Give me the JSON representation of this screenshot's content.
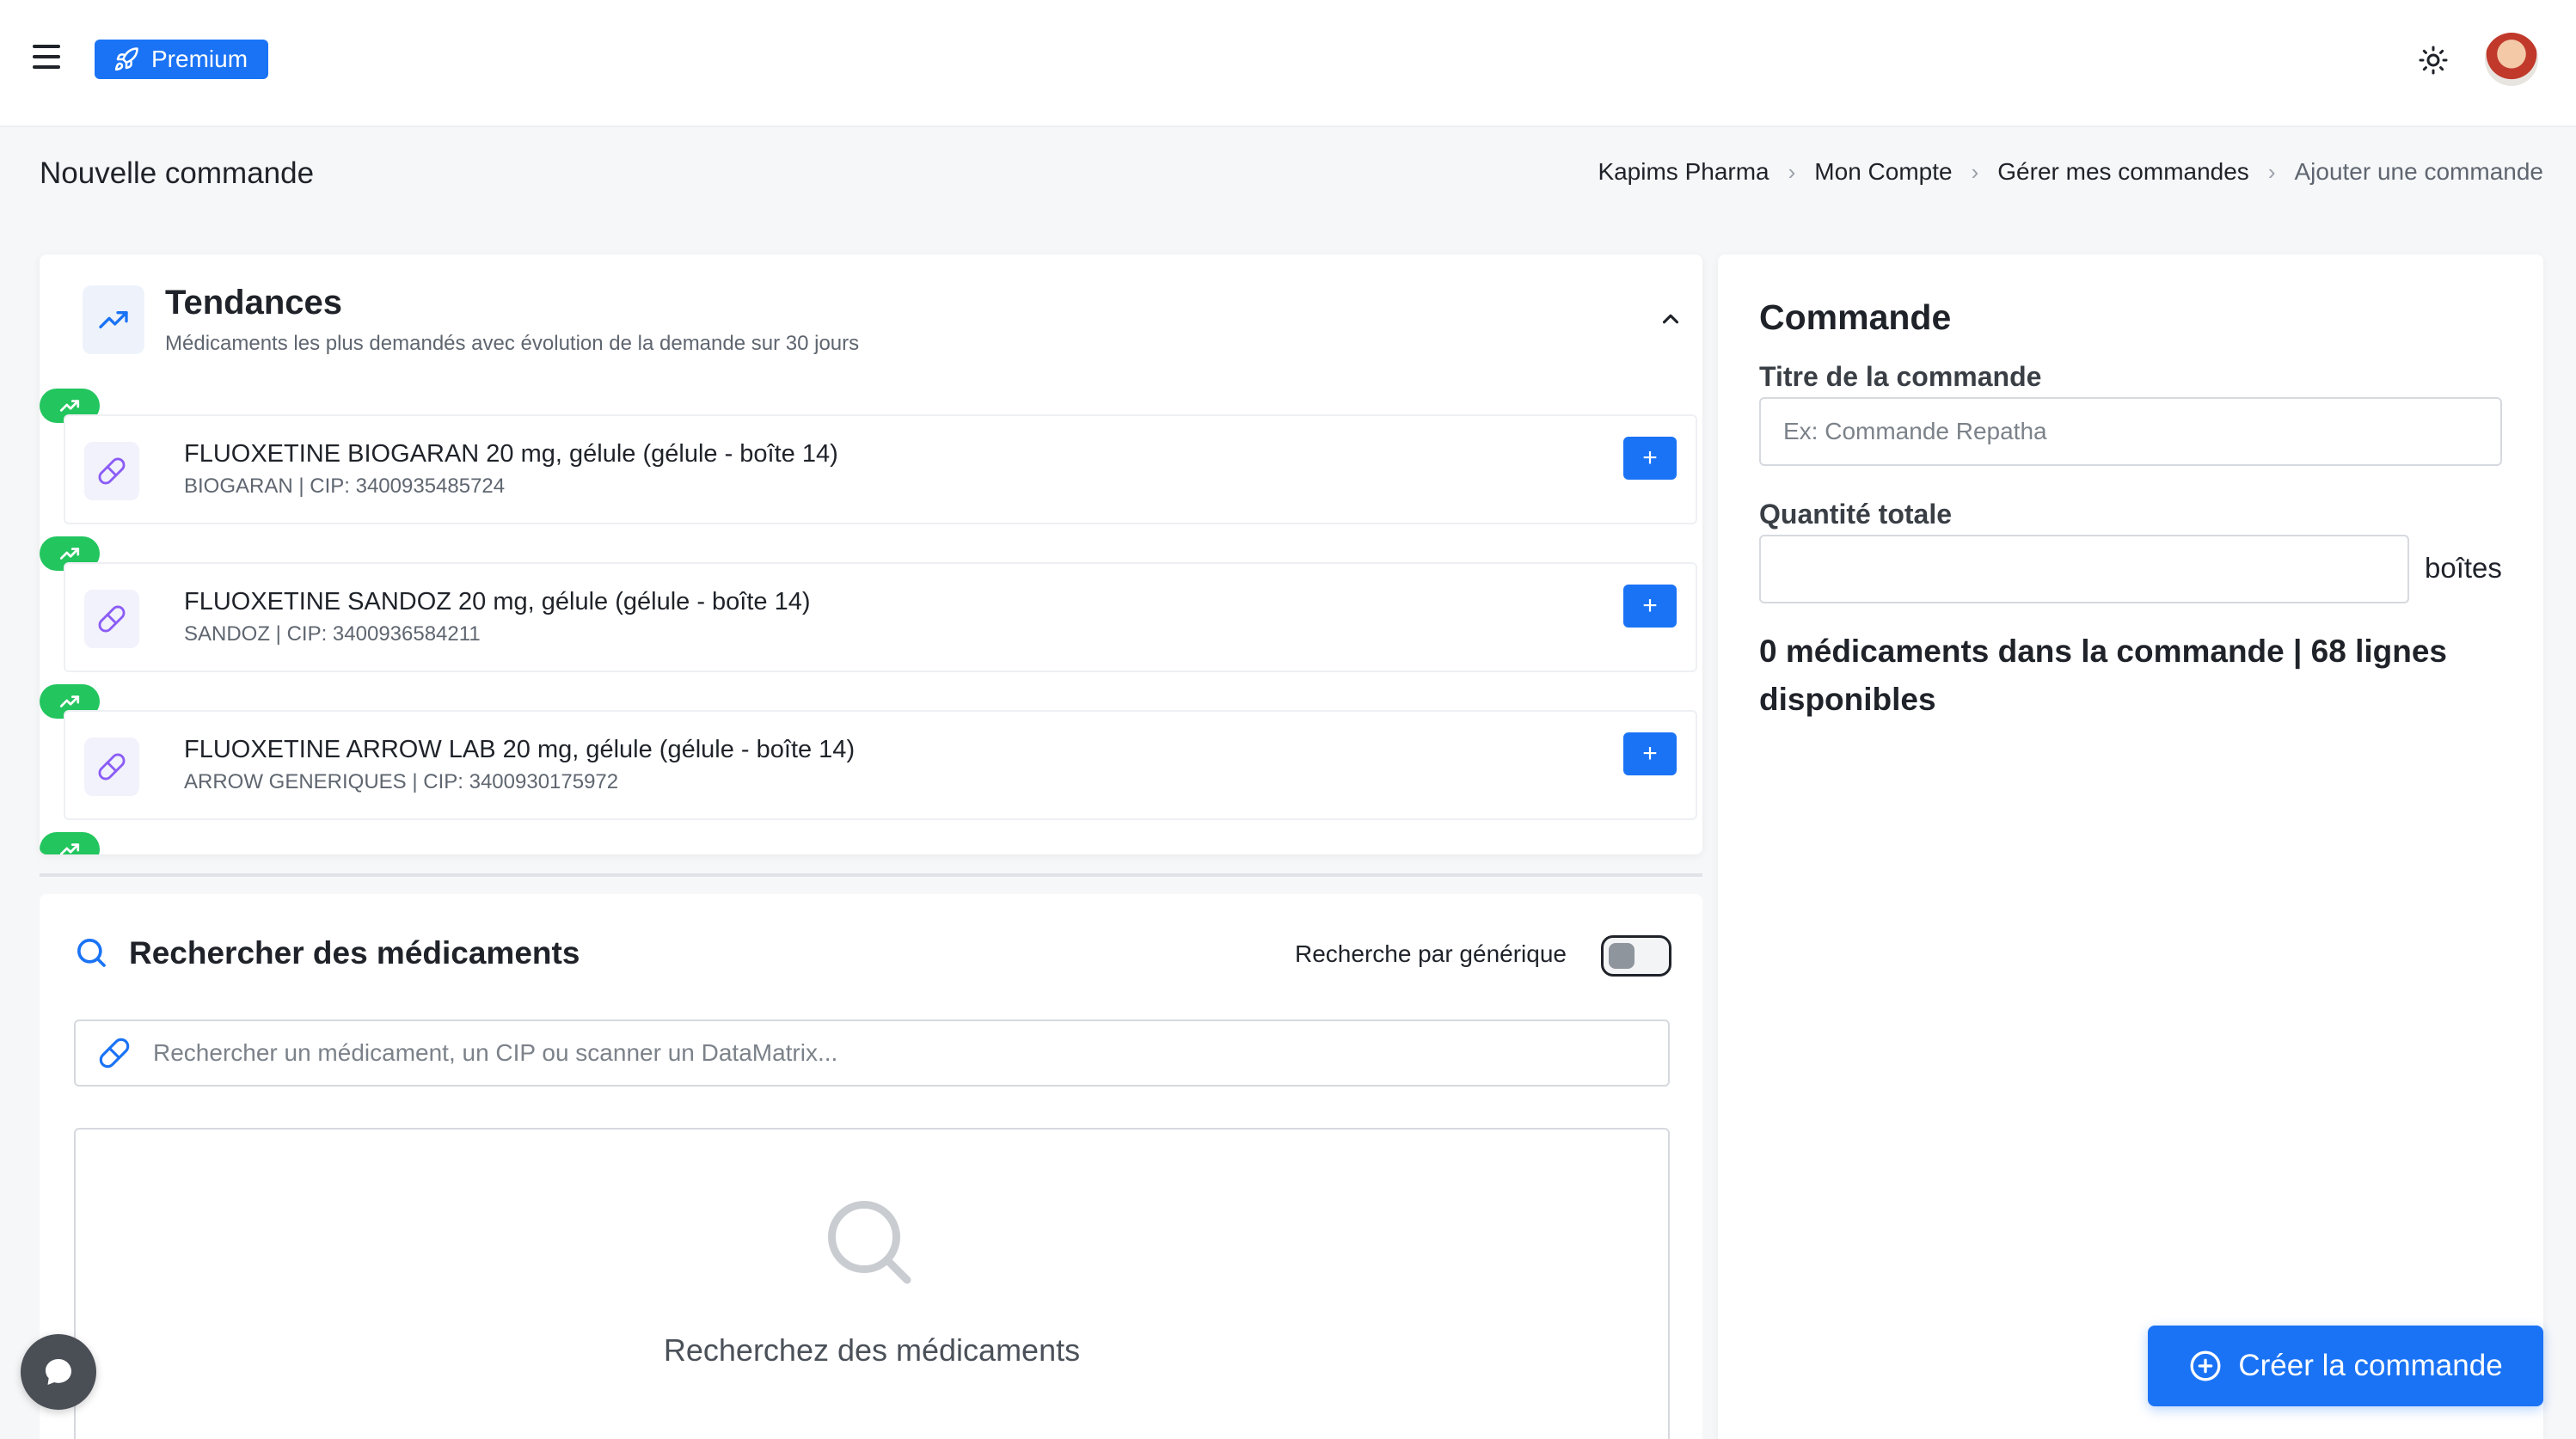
{
  "header": {
    "premium_label": "Premium",
    "theme_icon": "sun-icon",
    "avatar_icon": "user-avatar"
  },
  "page": {
    "title": "Nouvelle commande",
    "breadcrumb": [
      "Kapims Pharma",
      "Mon Compte",
      "Gérer mes commandes",
      "Ajouter une commande"
    ]
  },
  "trends": {
    "title": "Tendances",
    "subtitle": "Médicaments les plus demandés avec évolution de la demande sur 30 jours",
    "items": [
      {
        "name": "FLUOXETINE BIOGARAN 20 mg, gélule (gélule - boîte 14)",
        "meta": "BIOGARAN | CIP: 3400935485724",
        "add_label": "+"
      },
      {
        "name": "FLUOXETINE SANDOZ 20 mg, gélule (gélule - boîte 14)",
        "meta": "SANDOZ | CIP: 3400936584211",
        "add_label": "+"
      },
      {
        "name": "FLUOXETINE ARROW LAB 20 mg, gélule (gélule - boîte 14)",
        "meta": "ARROW GENERIQUES | CIP: 3400930175972",
        "add_label": "+"
      }
    ]
  },
  "search": {
    "title": "Rechercher des médicaments",
    "generic_label": "Recherche par générique",
    "generic_enabled": false,
    "placeholder": "Rechercher un médicament, un CIP ou scanner un DataMatrix...",
    "empty_text": "Recherchez des médicaments"
  },
  "order": {
    "title": "Commande",
    "title_label": "Titre de la commande",
    "title_placeholder": "Ex: Commande Repatha",
    "quantity_label": "Quantité totale",
    "quantity_value": "",
    "quantity_unit": "boîtes",
    "summary": "0 médicaments dans la commande | 68 lignes disponibles",
    "create_label": "Créer la commande"
  },
  "colors": {
    "accent": "#1a73f5",
    "trend_badge": "#22c55e"
  }
}
